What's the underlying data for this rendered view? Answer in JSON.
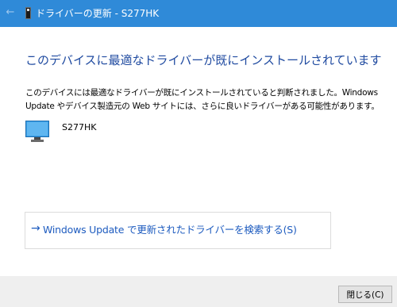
{
  "window": {
    "title": "ドライバーの更新 - S277HK",
    "back_icon": "back-arrow-icon",
    "device_icon": "device-icon"
  },
  "main": {
    "heading": "このデバイスに最適なドライバーが既にインストールされています",
    "description": "このデバイスには最適なドライバーが既にインストールされていると判断されました。Windows Update やデバイス製造元の Web サイトには、さらに良いドライバーがある可能性があります。",
    "device": {
      "name": "S277HK",
      "icon": "monitor-icon"
    },
    "search_option": {
      "arrow": "→",
      "label": "Windows Update で更新されたドライバーを検索する(S)"
    }
  },
  "footer": {
    "close_label": "閉じる(C)"
  },
  "colors": {
    "titlebar": "#2f8ad8",
    "heading": "#1f4aa0",
    "link": "#1d5bbf",
    "footer": "#efefef"
  }
}
